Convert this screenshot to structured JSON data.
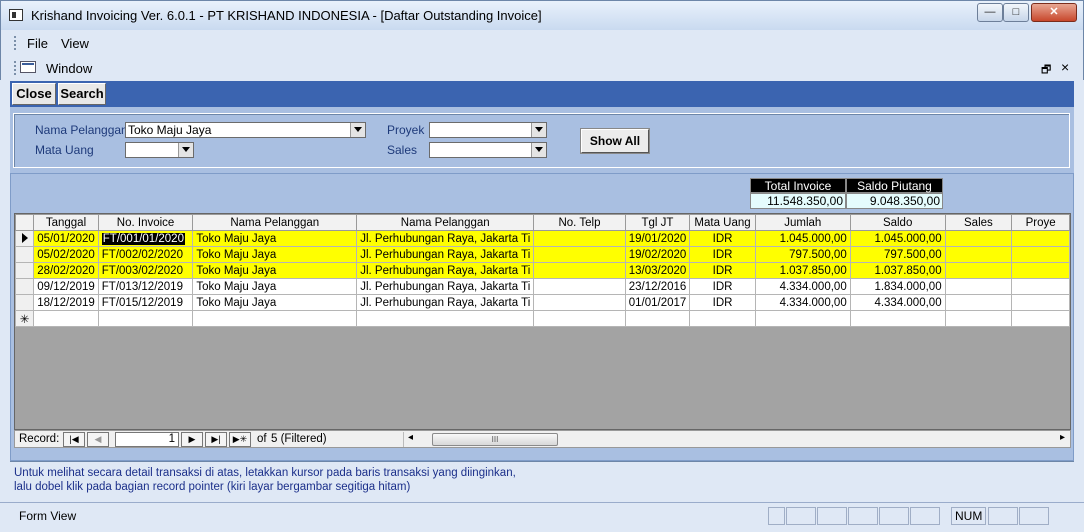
{
  "window": {
    "title": "Krishand Invoicing Ver. 6.0.1 - PT KRISHAND INDONESIA - [Daftar Outstanding Invoice]",
    "min_glyph": "—",
    "max_glyph": "□",
    "close_glyph": "✕"
  },
  "menu": {
    "file": "File",
    "view": "View",
    "window": "Window",
    "restore_glyph": "🗗",
    "close_glyph": "×"
  },
  "toolbar": {
    "close_label": "Close",
    "search_label": "Search"
  },
  "filters": {
    "nama_pelanggan_label": "Nama Pelanggan",
    "nama_pelanggan_value": "Toko Maju Jaya",
    "mata_uang_label": "Mata Uang",
    "mata_uang_value": "",
    "proyek_label": "Proyek",
    "proyek_value": "",
    "sales_label": "Sales",
    "sales_value": "",
    "show_all_label": "Show All"
  },
  "totals": {
    "total_invoice_label": "Total Invoice",
    "total_invoice_value": "11.548.350,00",
    "saldo_piutang_label": "Saldo Piutang",
    "saldo_piutang_value": "9.048.350,00"
  },
  "table": {
    "columns": [
      "Tanggal",
      "No. Invoice",
      "Nama Pelanggan",
      "Nama Pelanggan",
      "No. Telp",
      "Tgl JT",
      "Mata Uang",
      "Jumlah",
      "Saldo",
      "Sales",
      "Proye"
    ],
    "rows": [
      [
        "05/01/2020",
        "FT/001/01/2020",
        "Toko Maju Jaya",
        "Jl. Perhubungan Raya, Jakarta Ti",
        "",
        "19/01/2020",
        "IDR",
        "1.045.000,00",
        "1.045.000,00",
        "",
        ""
      ],
      [
        "05/02/2020",
        "FT/002/02/2020",
        "Toko Maju Jaya",
        "Jl. Perhubungan Raya, Jakarta Ti",
        "",
        "19/02/2020",
        "IDR",
        "797.500,00",
        "797.500,00",
        "",
        ""
      ],
      [
        "28/02/2020",
        "FT/003/02/2020",
        "Toko Maju Jaya",
        "Jl. Perhubungan Raya, Jakarta Ti",
        "",
        "13/03/2020",
        "IDR",
        "1.037.850,00",
        "1.037.850,00",
        "",
        ""
      ],
      [
        "09/12/2019",
        "FT/013/12/2019",
        "Toko Maju Jaya",
        "Jl. Perhubungan Raya, Jakarta Ti",
        "",
        "23/12/2016",
        "IDR",
        "4.334.000,00",
        "1.834.000,00",
        "",
        ""
      ],
      [
        "18/12/2019",
        "FT/015/12/2019",
        "Toko Maju Jaya",
        "Jl. Perhubungan Raya, Jakarta Ti",
        "",
        "01/01/2017",
        "IDR",
        "4.334.000,00",
        "4.334.000,00",
        "",
        ""
      ]
    ],
    "new_row_glyph": "✳"
  },
  "navigator": {
    "record_label": "Record:",
    "current": "1",
    "of_label": "of",
    "total_text": "5 (Filtered)",
    "first_glyph": "|◀",
    "prev_glyph": "◀",
    "next_glyph": "▶",
    "last_glyph": "▶|",
    "new_glyph": "▶✳",
    "scroll_left_glyph": "◂",
    "scroll_right_glyph": "▸",
    "thumb_glyph": "III"
  },
  "hint": {
    "line1": "Untuk melihat secara detail transaksi di atas, letakkan kursor pada baris transaksi yang diinginkan,",
    "line2": "lalu dobel klik pada bagian record pointer (kiri layar bergambar segitiga hitam)"
  },
  "status": {
    "mode": "Form View",
    "num": "NUM"
  },
  "colors": {
    "highlight_row": "#ffff00",
    "toolbar_bg": "#3b64b0",
    "filter_bg": "#a9bfe1",
    "hint_text": "#1b2f8a"
  }
}
